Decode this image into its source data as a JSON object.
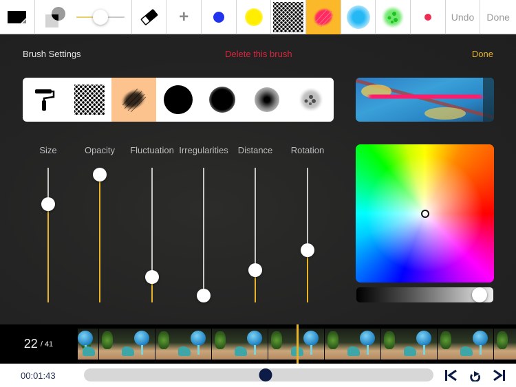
{
  "toolbar": {
    "items": [
      {
        "name": "canvas-layer-icon"
      },
      {
        "name": "blend-opacity-icon",
        "opacity_value": 0.35
      },
      {
        "name": "eraser-icon"
      },
      {
        "name": "add-brush-icon",
        "label": "+"
      },
      {
        "name": "brush-blue",
        "color": "#2233ee"
      },
      {
        "name": "brush-yellow",
        "color": "#ffee00"
      },
      {
        "name": "brush-halftone",
        "color": "#000000"
      },
      {
        "name": "brush-red-scribble",
        "color": "#ff2b5e",
        "selected": true
      },
      {
        "name": "brush-cyan-soft",
        "color": "#26b8f5"
      },
      {
        "name": "brush-green-splatter",
        "color": "#36d936"
      },
      {
        "name": "brush-pink-dot",
        "color": "#ee2d55"
      }
    ],
    "undo_label": "Undo",
    "done_label": "Done",
    "selected_bg": "#fbb829"
  },
  "brush_settings": {
    "title": "Brush Settings",
    "delete_label": "Delete this brush",
    "done_label": "Done",
    "brush_types": [
      {
        "name": "paint-roller-icon",
        "selected": false
      },
      {
        "name": "halftone-brush-icon",
        "selected": false
      },
      {
        "name": "scribble-brush-icon",
        "selected": true
      },
      {
        "name": "hard-round-brush-icon",
        "selected": false
      },
      {
        "name": "medium-soft-brush-icon",
        "selected": false
      },
      {
        "name": "soft-brush-icon",
        "selected": false
      },
      {
        "name": "splatter-brush-icon",
        "selected": false
      }
    ],
    "sliders": [
      {
        "label": "Size",
        "value": 0.73
      },
      {
        "label": "Opacity",
        "value": 0.95
      },
      {
        "label": "Fluctuation",
        "value": 0.19
      },
      {
        "label": "Irregularities",
        "value": 0.05
      },
      {
        "label": "Distance",
        "value": 0.24
      },
      {
        "label": "Rotation",
        "value": 0.39
      }
    ],
    "color_picker": {
      "cursor_x": 0.5,
      "cursor_y": 0.5,
      "brightness": 0.95
    },
    "accent_color": "#e8b42a",
    "delete_color": "#d7263d"
  },
  "filmstrip": {
    "current_frame": "22",
    "total_frames": "/ 41",
    "frame_count_visible": 8,
    "playhead_position": 0.501
  },
  "playback": {
    "time": "00:01:43",
    "progress": 0.52,
    "controls": [
      {
        "name": "jump-to-start-icon"
      },
      {
        "name": "loop-play-icon"
      },
      {
        "name": "jump-to-end-icon"
      }
    ]
  }
}
